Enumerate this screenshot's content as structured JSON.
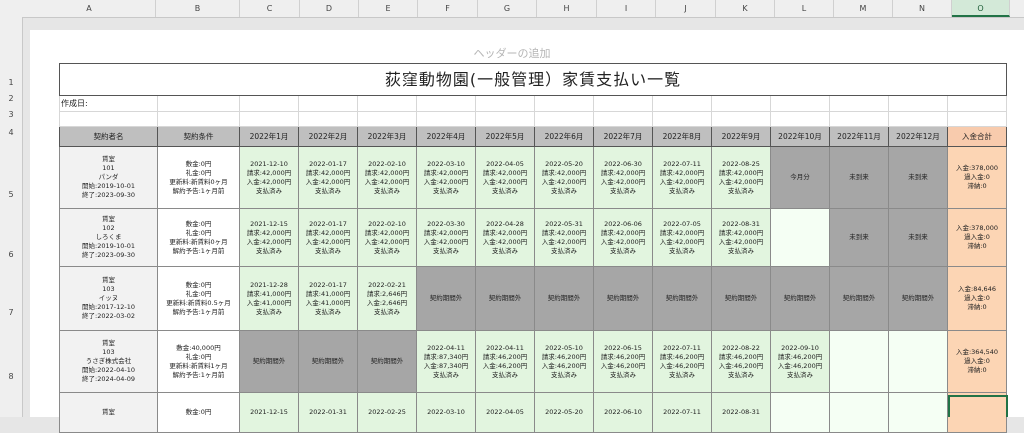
{
  "columns": [
    "A",
    "B",
    "C",
    "D",
    "E",
    "F",
    "G",
    "H",
    "I",
    "J",
    "K",
    "L",
    "M",
    "N",
    "O"
  ],
  "selected_column": "O",
  "row_numbers": [
    "1",
    "2",
    "3",
    "4",
    "5",
    "6",
    "7",
    "8"
  ],
  "header_hint": "ヘッダーの追加",
  "title": "荻窪動物園(一般管理）家賃支払い一覧",
  "created_label": "作成日:",
  "table_headers": [
    "契約者名",
    "契約条件",
    "2022年1月",
    "2022年2月",
    "2022年3月",
    "2022年4月",
    "2022年5月",
    "2022年6月",
    "2022年7月",
    "2022年8月",
    "2022年9月",
    "2022年10月",
    "2022年11月",
    "2022年12月",
    "入金合計"
  ],
  "rows": [
    {
      "party": "賃室\n101\nパンダ\n開始:2019-10-01\n終了:2023-09-30",
      "conditions": "敷金:0円\n礼金:0円\n更新料:新賃料0ヶ月\n解約予告:1ヶ月前",
      "months": [
        {
          "status": "paid",
          "text": "2021-12-10\n請求:42,000円\n入金:42,000円\n支払済み"
        },
        {
          "status": "paid",
          "text": "2022-01-17\n請求:42,000円\n入金:42,000円\n支払済み"
        },
        {
          "status": "paid",
          "text": "2022-02-10\n請求:42,000円\n入金:42,000円\n支払済み"
        },
        {
          "status": "paid",
          "text": "2022-03-10\n請求:42,000円\n入金:42,000円\n支払済み"
        },
        {
          "status": "paid",
          "text": "2022-04-05\n請求:42,000円\n入金:42,000円\n支払済み"
        },
        {
          "status": "paid",
          "text": "2022-05-20\n請求:42,000円\n入金:42,000円\n支払済み"
        },
        {
          "status": "paid",
          "text": "2022-06-30\n請求:42,000円\n入金:42,000円\n支払済み"
        },
        {
          "status": "paid",
          "text": "2022-07-11\n請求:42,000円\n入金:42,000円\n支払済み"
        },
        {
          "status": "paid",
          "text": "2022-08-25\n請求:42,000円\n入金:42,000円\n支払済み"
        },
        {
          "status": "grey",
          "text": "今月分"
        },
        {
          "status": "grey",
          "text": "未到来"
        },
        {
          "status": "grey",
          "text": "未到来"
        }
      ],
      "total": "入金:378,000\n過入金:0\n滞納:0"
    },
    {
      "party": "賃室\n102\nしろくま\n開始:2019-10-01\n終了:2023-09-30",
      "conditions": "敷金:0円\n礼金:0円\n更新料:新賃料0ヶ月\n解約予告:1ヶ月前",
      "months": [
        {
          "status": "paid",
          "text": "2021-12-15\n請求:42,000円\n入金:42,000円\n支払済み"
        },
        {
          "status": "paid",
          "text": "2022-01-17\n請求:42,000円\n入金:42,000円\n支払済み"
        },
        {
          "status": "paid",
          "text": "2022-02-10\n請求:42,000円\n入金:42,000円\n支払済み"
        },
        {
          "status": "paid",
          "text": "2022-03-30\n請求:42,000円\n入金:42,000円\n支払済み"
        },
        {
          "status": "paid",
          "text": "2022-04-28\n請求:42,000円\n入金:42,000円\n支払済み"
        },
        {
          "status": "paid",
          "text": "2022-05-31\n請求:42,000円\n入金:42,000円\n支払済み"
        },
        {
          "status": "paid",
          "text": "2022-06-06\n請求:42,000円\n入金:42,000円\n支払済み"
        },
        {
          "status": "paid",
          "text": "2022-07-05\n請求:42,000円\n入金:42,000円\n支払済み"
        },
        {
          "status": "paid",
          "text": "2022-08-31\n請求:42,000円\n入金:42,000円\n支払済み"
        },
        {
          "status": "pending",
          "text": ""
        },
        {
          "status": "grey",
          "text": "未到来"
        },
        {
          "status": "grey",
          "text": "未到来"
        }
      ],
      "total": "入金:378,000\n過入金:0\n滞納:0"
    },
    {
      "party": "賃室\n103\nイッヌ\n開始:2017-12-10\n終了:2022-03-02",
      "conditions": "敷金:0円\n礼金:0円\n更新料:新賃料0.5ヶ月\n解約予告:1ヶ月前",
      "months": [
        {
          "status": "paid",
          "text": "2021-12-28\n請求:41,000円\n入金:41,000円\n支払済み"
        },
        {
          "status": "paid",
          "text": "2022-01-17\n請求:41,000円\n入金:41,000円\n支払済み"
        },
        {
          "status": "paid",
          "text": "2022-02-21\n請求:2,646円\n入金:2,646円\n支払済み"
        },
        {
          "status": "grey",
          "text": "契約期間外"
        },
        {
          "status": "grey",
          "text": "契約期間外"
        },
        {
          "status": "grey",
          "text": "契約期間外"
        },
        {
          "status": "grey",
          "text": "契約期間外"
        },
        {
          "status": "grey",
          "text": "契約期間外"
        },
        {
          "status": "grey",
          "text": "契約期間外"
        },
        {
          "status": "grey",
          "text": "契約期間外"
        },
        {
          "status": "grey",
          "text": "契約期間外"
        },
        {
          "status": "grey",
          "text": "契約期間外"
        }
      ],
      "total": "入金:84,646\n過入金:0\n滞納:0"
    },
    {
      "party": "賃室\n103\nうさぎ株式会社\n開始:2022-04-10\n終了:2024-04-09",
      "conditions": "敷金:40,000円\n礼金:0円\n更新料:新賃料1ヶ月\n解約予告:1ヶ月前",
      "months": [
        {
          "status": "grey",
          "text": "契約期間外"
        },
        {
          "status": "grey",
          "text": "契約期間外"
        },
        {
          "status": "grey",
          "text": "契約期間外"
        },
        {
          "status": "paid",
          "text": "2022-04-11\n請求:87,340円\n入金:87,340円\n支払済み"
        },
        {
          "status": "paid",
          "text": "2022-04-11\n請求:46,200円\n入金:46,200円\n支払済み"
        },
        {
          "status": "paid",
          "text": "2022-05-10\n請求:46,200円\n入金:46,200円\n支払済み"
        },
        {
          "status": "paid",
          "text": "2022-06-15\n請求:46,200円\n入金:46,200円\n支払済み"
        },
        {
          "status": "paid",
          "text": "2022-07-11\n請求:46,200円\n入金:46,200円\n支払済み"
        },
        {
          "status": "paid",
          "text": "2022-08-22\n請求:46,200円\n入金:46,200円\n支払済み"
        },
        {
          "status": "paid",
          "text": "2022-09-10\n請求:46,200円\n入金:46,200円\n支払済み"
        },
        {
          "status": "pending",
          "text": ""
        },
        {
          "status": "pending",
          "text": ""
        }
      ],
      "total": "入金:364,540\n過入金:0\n滞納:0"
    },
    {
      "party": "賃室",
      "conditions": "敷金:0円",
      "months": [
        {
          "status": "paid",
          "text": "2021-12-15"
        },
        {
          "status": "paid",
          "text": "2022-01-31"
        },
        {
          "status": "paid",
          "text": "2022-02-25"
        },
        {
          "status": "paid",
          "text": "2022-03-10"
        },
        {
          "status": "paid",
          "text": "2022-04-05"
        },
        {
          "status": "paid",
          "text": "2022-05-20"
        },
        {
          "status": "paid",
          "text": "2022-06-10"
        },
        {
          "status": "paid",
          "text": "2022-07-11"
        },
        {
          "status": "paid",
          "text": "2022-08-31"
        },
        {
          "status": "pending",
          "text": ""
        },
        {
          "status": "pending",
          "text": ""
        },
        {
          "status": "pending",
          "text": ""
        }
      ],
      "total": ""
    }
  ]
}
